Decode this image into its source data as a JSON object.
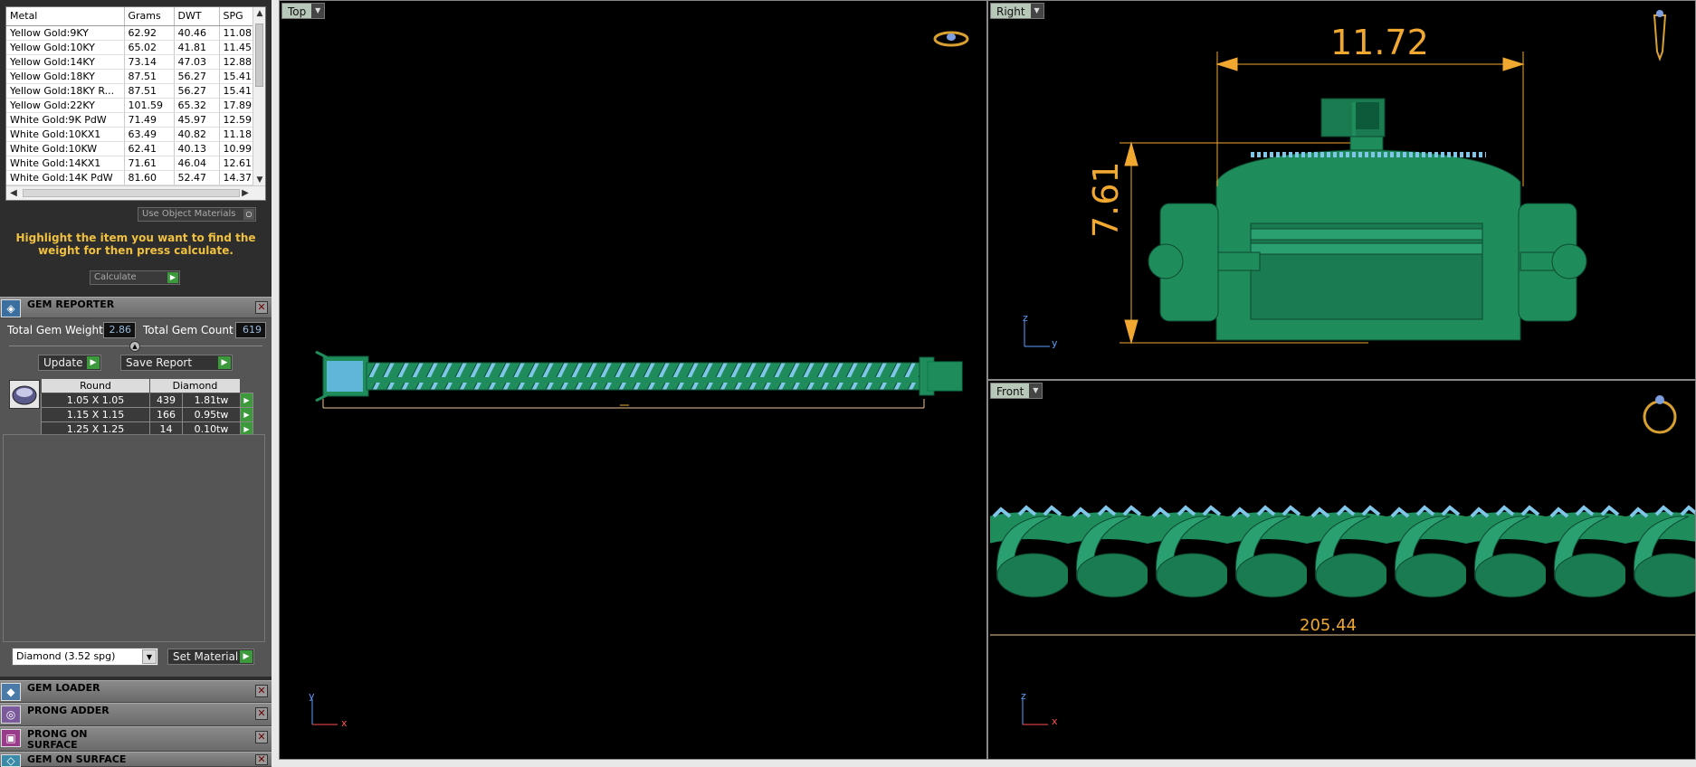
{
  "metal_table": {
    "headers": [
      "Metal",
      "Grams",
      "DWT",
      "SPG"
    ],
    "rows": [
      [
        "Yellow Gold:9KY",
        "62.92",
        "40.46",
        "11.08"
      ],
      [
        "Yellow Gold:10KY",
        "65.02",
        "41.81",
        "11.45"
      ],
      [
        "Yellow Gold:14KY",
        "73.14",
        "47.03",
        "12.88"
      ],
      [
        "Yellow Gold:18KY",
        "87.51",
        "56.27",
        "15.41"
      ],
      [
        "Yellow Gold:18KY R...",
        "87.51",
        "56.27",
        "15.41"
      ],
      [
        "Yellow Gold:22KY",
        "101.59",
        "65.32",
        "17.89"
      ],
      [
        "White Gold:9K PdW",
        "71.49",
        "45.97",
        "12.59"
      ],
      [
        "White Gold:10KX1",
        "63.49",
        "40.82",
        "11.18"
      ],
      [
        "White Gold:10KW",
        "62.41",
        "40.13",
        "10.99"
      ],
      [
        "White Gold:14KX1",
        "71.61",
        "46.04",
        "12.61"
      ],
      [
        "White Gold:14K PdW",
        "81.60",
        "52.47",
        "14.37"
      ]
    ]
  },
  "use_object_materials": "Use Object Materials",
  "hint_text": "Highlight the item you want to find the weight for then press calculate.",
  "calculate_label": "Calculate",
  "gem_reporter": {
    "title": "GEM REPORTER",
    "total_weight_label": "Total Gem Weight",
    "total_weight_value": "2.86",
    "total_count_label": "Total Gem Count",
    "total_count_value": "619",
    "update_label": "Update",
    "save_report_label": "Save Report",
    "table_headers": [
      "Round",
      "Diamond"
    ],
    "rows": [
      [
        "1.05 X 1.05",
        "439",
        "1.81tw"
      ],
      [
        "1.15 X 1.15",
        "166",
        "0.95tw"
      ],
      [
        "1.25 X 1.25",
        "14",
        "0.10tw"
      ]
    ],
    "material_select": "Diamond    (3.52 spg)",
    "set_material_label": "Set Material"
  },
  "panels": [
    {
      "title": "GEM LOADER"
    },
    {
      "title": "PRONG ADDER"
    },
    {
      "title": "PRONG ON SURFACE"
    },
    {
      "title": "GEM ON SURFACE"
    }
  ],
  "viewports": {
    "top": {
      "label": "Top"
    },
    "right": {
      "label": "Right",
      "dim_width": "11.72",
      "dim_height": "7.61",
      "axis_v": "z",
      "axis_h": "y"
    },
    "front": {
      "label": "Front",
      "dim_length": "205.44",
      "axis_v": "z",
      "axis_h": "x"
    },
    "top_axes": {
      "axis_v": "y",
      "axis_h": "x"
    }
  },
  "colors": {
    "model_green": "#1f8c5c",
    "gem_blue": "#7fc6e8",
    "dimension_orange": "#f0a830"
  }
}
